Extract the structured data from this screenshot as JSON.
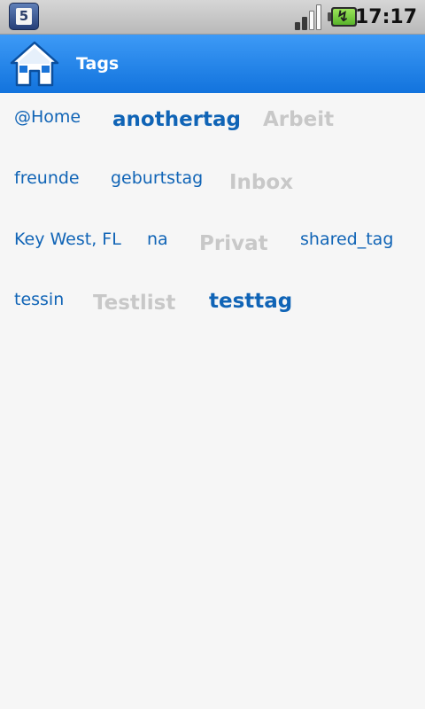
{
  "status_bar": {
    "notification_icon": "calendar-5-icon",
    "notification_text": "5",
    "signal_icon": "signal-bars-icon",
    "battery_icon": "battery-charging-icon",
    "time": "17:17"
  },
  "title_bar": {
    "home_icon": "home-icon",
    "title": "Tags",
    "background_color": "#1e82ea"
  },
  "tags": [
    {
      "label": "@Home",
      "style": "small"
    },
    {
      "label": "anothertag",
      "style": "big-blue"
    },
    {
      "label": "Arbeit",
      "style": "big-muted"
    },
    {
      "label": "freunde",
      "style": "small"
    },
    {
      "label": "geburtstag",
      "style": "small"
    },
    {
      "label": "Inbox",
      "style": "big-muted"
    },
    {
      "label": "Key West, FL",
      "style": "small"
    },
    {
      "label": "na",
      "style": "small"
    },
    {
      "label": "Privat",
      "style": "big-muted"
    },
    {
      "label": "shared_tag",
      "style": "small"
    },
    {
      "label": "tessin",
      "style": "small"
    },
    {
      "label": "Testlist",
      "style": "big-muted"
    },
    {
      "label": "testtag",
      "style": "big-blue"
    }
  ],
  "colors": {
    "tag_link": "#1064b6",
    "tag_muted": "#c8c8c8"
  }
}
